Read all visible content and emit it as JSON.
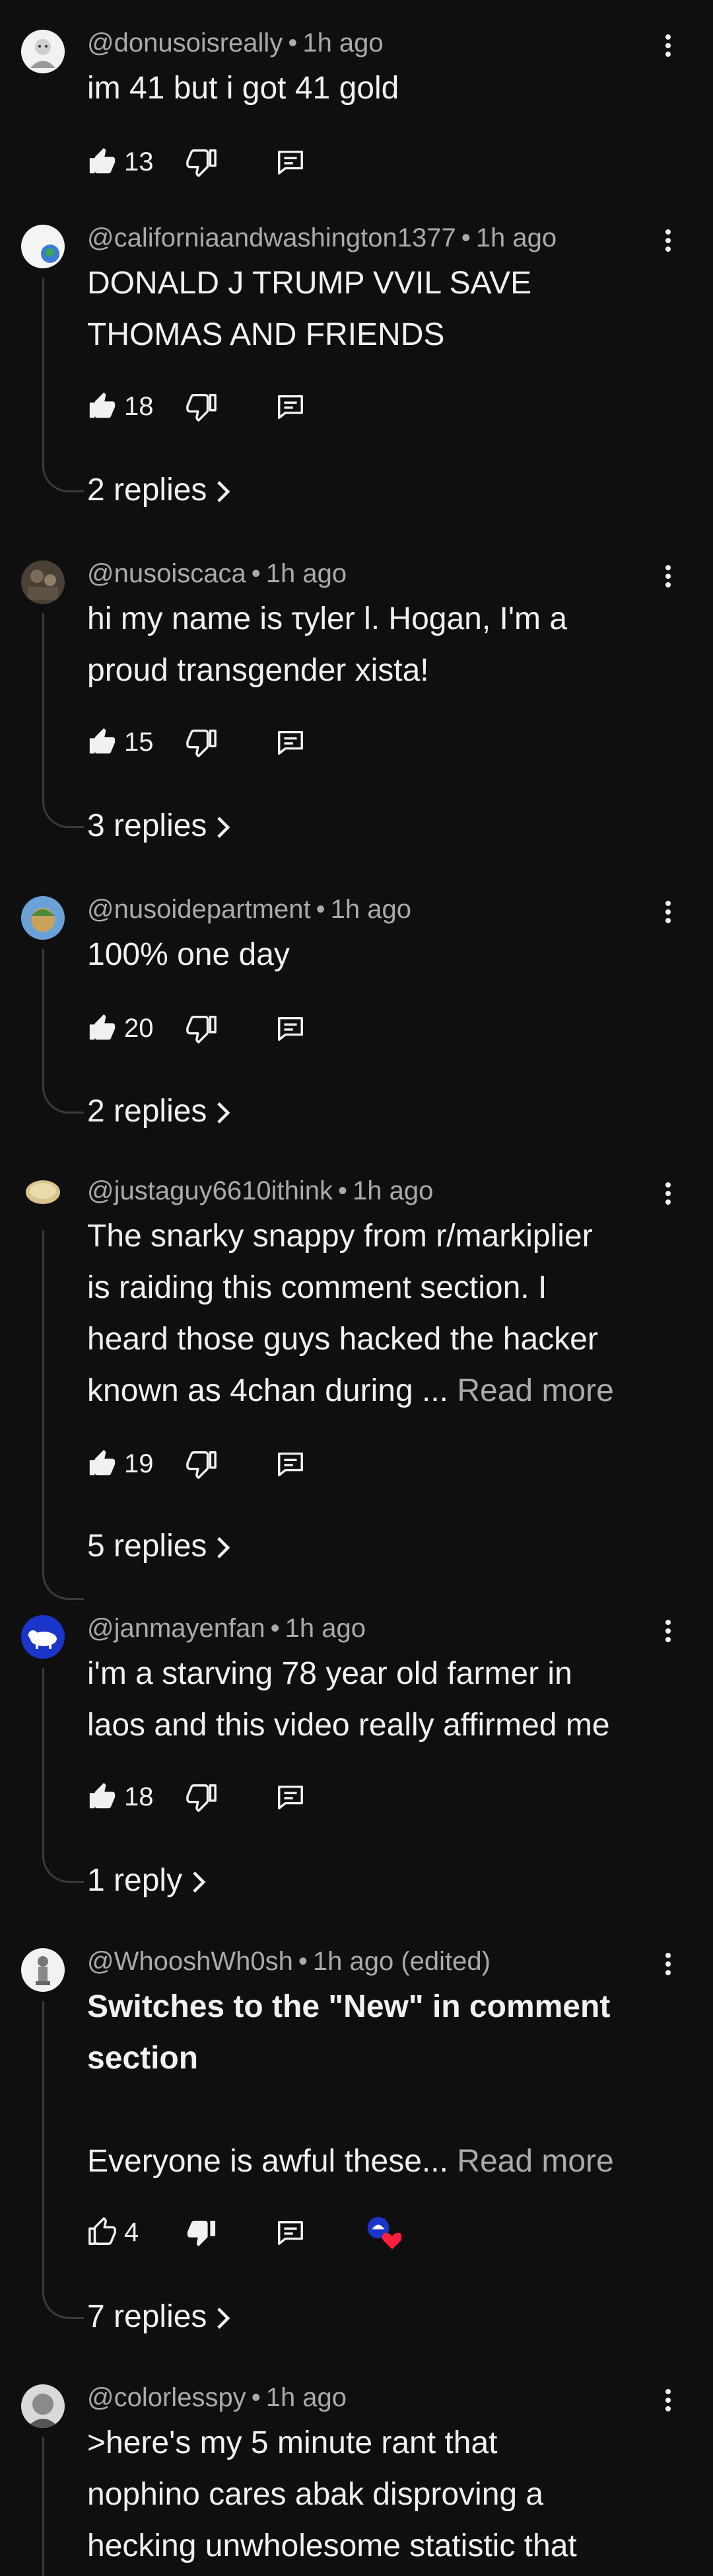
{
  "comments": [
    {
      "handle": "@donusoisreally",
      "time": "1h ago",
      "text_lines": [
        "im 41 but i got 41 gold"
      ],
      "likes": "13",
      "replies": ""
    },
    {
      "handle": "@californiaandwashington1377",
      "time": "1h ago",
      "text_lines": [
        "DONALD J TRUMP VVIL SAVE",
        "THOMAS AND FRIENDS"
      ],
      "likes": "18",
      "replies": "2 replies"
    },
    {
      "handle": "@nusoiscaca",
      "time": "1h ago",
      "text_lines": [
        "hi my name is τyler l. Hogan, I'm a",
        "proud transgender xista!"
      ],
      "likes": "15",
      "replies": "3 replies"
    },
    {
      "handle": "@nusoidepartment",
      "time": "1h ago",
      "text_lines": [
        "100% one day"
      ],
      "likes": "20",
      "replies": "2 replies"
    },
    {
      "handle": "@justaguy6610ithink",
      "time": "1h ago",
      "text_lines": [
        "The snarky snappy from r/markiplier",
        "is raiding this comment section. I",
        "heard those guys hacked the hacker",
        "known as 4chan during ..."
      ],
      "read_more": "Read more",
      "likes": "19",
      "replies": "5 replies"
    },
    {
      "handle": "@janmayenfan",
      "time": "1h ago",
      "text_lines": [
        "i'm a starving 78 year old farmer in",
        "laos and this video really affirmed me"
      ],
      "likes": "18",
      "replies": "1 reply"
    },
    {
      "handle": "@WhooshWh0sh",
      "time": "1h ago (edited)",
      "text_lines": [
        "Switches to the \"New\" in comment",
        "section",
        "",
        "Everyone is awful these..."
      ],
      "read_more": "Read more",
      "likes": "4",
      "replies": "7 replies"
    },
    {
      "handle": "@colorlesspy",
      "time": "1h ago",
      "text_lines": [
        ">here's my 5 minute rant that",
        "nophino cares abak disproving a",
        "hecking unwholesome statistic that"
      ],
      "likes": "",
      "replies": ""
    }
  ],
  "meta_separator": "•",
  "icons": {
    "like": "thumbs-up-icon",
    "dislike": "thumbs-down-icon",
    "reply": "comment-reply-icon",
    "menu": "more-vertical-icon",
    "chevron": "chevron-right-icon"
  },
  "colors": {
    "background": "#0f0f0f",
    "primary_text": "#f1f1f1",
    "secondary_text": "#aaaaaa",
    "heart": "#ff1f3d"
  }
}
